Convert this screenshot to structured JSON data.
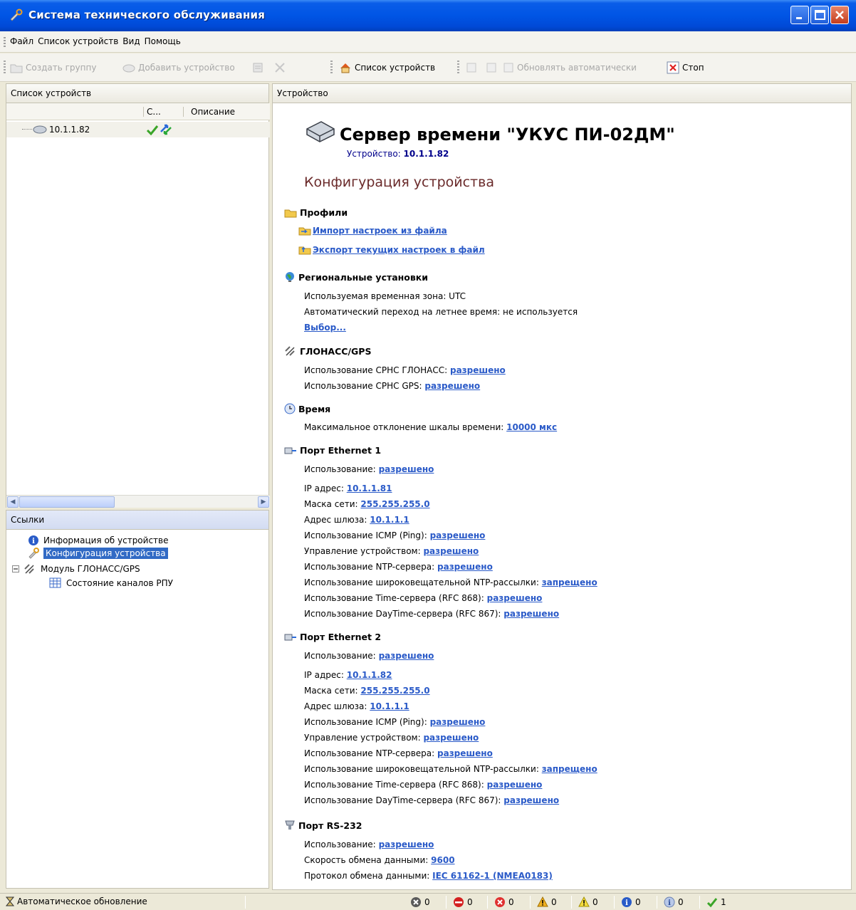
{
  "window": {
    "title": "Система технического обслуживания"
  },
  "menu": [
    "Файл",
    "Список устройств",
    "Вид",
    "Помощь"
  ],
  "toolbar": {
    "create_group": "Создать группу",
    "add_device": "Добавить устройство",
    "device_list": "Список устройств",
    "auto_update": "Обновлять автоматически",
    "stop": "Стоп"
  },
  "left_panel": {
    "header": "Список устройств",
    "col_status": "С...",
    "col_description": "Описание",
    "device_ip": "10.1.1.82"
  },
  "links_panel": {
    "header": "Ссылки",
    "items": [
      "Информация об устройстве",
      "Конфигурация устройства",
      "Модуль ГЛОНАСС/GPS",
      "Состояние каналов РПУ"
    ]
  },
  "right_panel": {
    "header": "Устройство",
    "device_title": "Сервер времени \"УКУС ПИ-02ДМ\"",
    "device_label": "Устройство:",
    "device_ip": "10.1.1.82",
    "config_title": "Конфигурация устройства",
    "profiles": {
      "title": "Профили",
      "import": "Импорт настроек из файла",
      "export": "Экспорт текущих настроек в файл"
    },
    "regional": {
      "title": "Региональные установки",
      "timezone": "Используемая временная зона: UTC",
      "dst": "Автоматический переход на летнее время: не используется",
      "choose": "Выбор..."
    },
    "gnss": {
      "title": "ГЛОНАСС/GPS",
      "glonass_label": "Использование СРНС ГЛОНАСС:",
      "glonass_value": "разрешено",
      "gps_label": "Использование СРНС GPS:",
      "gps_value": "разрешено"
    },
    "time": {
      "title": "Время",
      "dev_label": "Максимальное отклонение шкалы времени:",
      "dev_value": "10000 мкс"
    },
    "eth1": {
      "title": "Порт Ethernet 1",
      "usage_label": "Использование:",
      "usage": "разрешено",
      "ip_label": "IP адрес:",
      "ip": "10.1.1.81",
      "mask_label": "Маска сети:",
      "mask": "255.255.255.0",
      "gw_label": "Адрес шлюза:",
      "gw": "10.1.1.1",
      "icmp_label": "Использование ICMP (Ping):",
      "icmp": "разрешено",
      "mgmt_label": "Управление устройством:",
      "mgmt": "разрешено",
      "ntp_label": "Использование NTP-сервера:",
      "ntp": "разрешено",
      "bcast_label": "Использование широковещательной NTP-рассылки:",
      "bcast": "запрещено",
      "time_label": "Использование Time-сервера (RFC 868):",
      "time": "разрешено",
      "daytime_label": "Использование DayTime-сервера (RFC 867):",
      "daytime": "разрешено"
    },
    "eth2": {
      "title": "Порт Ethernet 2",
      "usage_label": "Использование:",
      "usage": "разрешено",
      "ip_label": "IP адрес:",
      "ip": "10.1.1.82",
      "mask_label": "Маска сети:",
      "mask": "255.255.255.0",
      "gw_label": "Адрес шлюза:",
      "gw": "10.1.1.1",
      "icmp_label": "Использование ICMP (Ping):",
      "icmp": "разрешено",
      "mgmt_label": "Управление устройством:",
      "mgmt": "разрешено",
      "ntp_label": "Использование NTP-сервера:",
      "ntp": "разрешено",
      "bcast_label": "Использование широковещательной NTP-рассылки:",
      "bcast": "запрещено",
      "time_label": "Использование Time-сервера (RFC 868):",
      "time": "разрешено",
      "daytime_label": "Использование DayTime-сервера (RFC 867):",
      "daytime": "разрешено"
    },
    "rs232": {
      "title": "Порт RS-232",
      "usage_label": "Использование:",
      "usage": "разрешено",
      "speed_label": "Скорость обмена данными:",
      "speed": "9600",
      "proto_label": "Протокол обмена данными:",
      "proto": "IEC 61162-1 (NMEA0183)"
    }
  },
  "status_bar": {
    "auto_update": "Автоматическое обновление",
    "counts": [
      "0",
      "0",
      "0",
      "0",
      "0",
      "0",
      "0",
      "1"
    ]
  }
}
